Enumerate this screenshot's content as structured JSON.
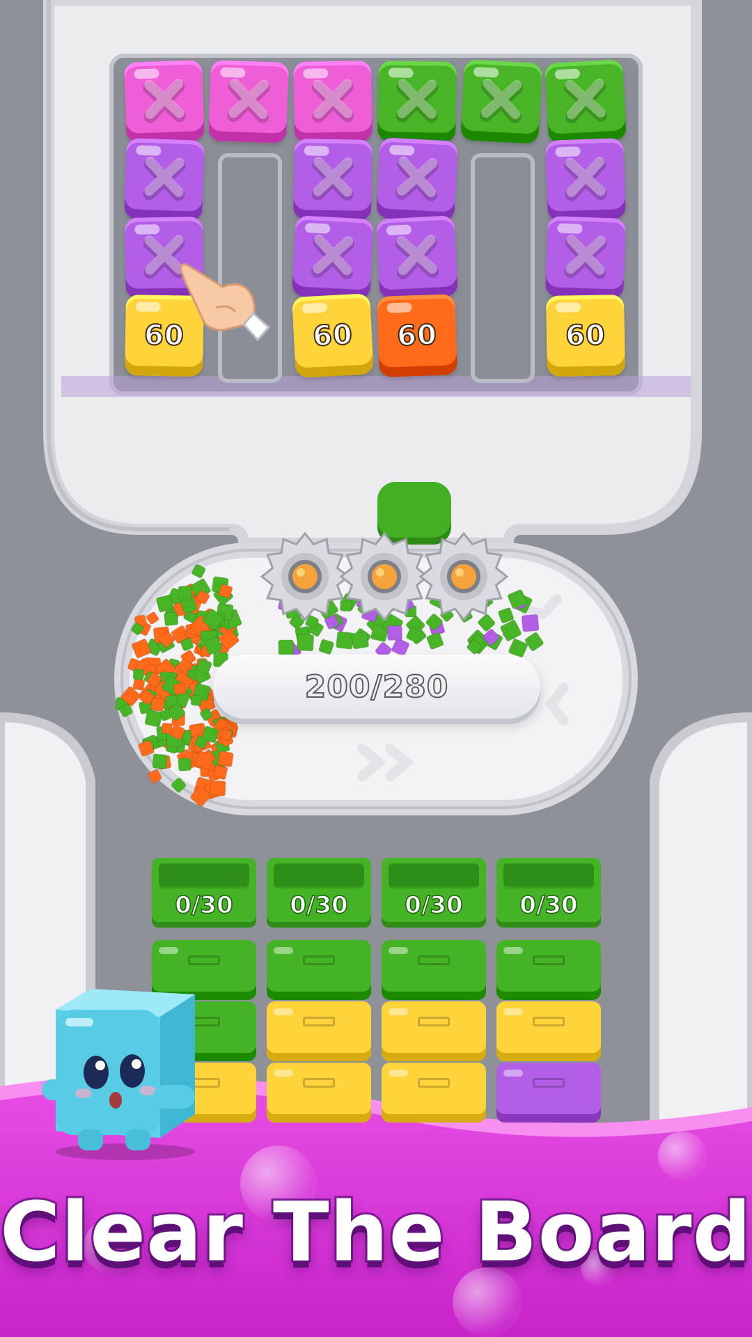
{
  "game": {
    "title": "Clear The Board",
    "counter": {
      "current": 200,
      "total": 280,
      "text": "200/280"
    },
    "grid": {
      "columns": [
        {
          "blocks": [
            {
              "color": "#ee5ed6",
              "kind": "x"
            },
            {
              "color": "#b25ee6",
              "kind": "x"
            },
            {
              "color": "#b25ee6",
              "kind": "x"
            },
            {
              "color": "#ffd43a",
              "kind": "number",
              "value": "60"
            }
          ]
        },
        {
          "blocks": [
            {
              "color": "#ee5ed6",
              "kind": "x"
            }
          ]
        },
        {
          "blocks": [
            {
              "color": "#ee5ed6",
              "kind": "x"
            },
            {
              "color": "#b25ee6",
              "kind": "x"
            },
            {
              "color": "#b25ee6",
              "kind": "x"
            },
            {
              "color": "#ffd43a",
              "kind": "number",
              "value": "60"
            }
          ]
        },
        {
          "blocks": [
            {
              "color": "#48b526",
              "kind": "x"
            },
            {
              "color": "#b25ee6",
              "kind": "x"
            },
            {
              "color": "#b25ee6",
              "kind": "x"
            },
            {
              "color": "#ff6b1a",
              "kind": "number",
              "value": "60"
            }
          ]
        },
        {
          "blocks": [
            {
              "color": "#48b526",
              "kind": "x"
            }
          ]
        },
        {
          "blocks": [
            {
              "color": "#48b526",
              "kind": "x"
            },
            {
              "color": "#b25ee6",
              "kind": "x"
            },
            {
              "color": "#b25ee6",
              "kind": "x"
            },
            {
              "color": "#ffd43a",
              "kind": "number",
              "value": "60"
            }
          ]
        }
      ]
    },
    "containers": [
      {
        "label": "0/30",
        "color": "#44b325",
        "stack": [
          "#44b325",
          "#44b325",
          "#ffd43a"
        ]
      },
      {
        "label": "0/30",
        "color": "#44b325",
        "stack": [
          "#44b325",
          "#ffd43a",
          "#ffd43a"
        ]
      },
      {
        "label": "0/30",
        "color": "#44b325",
        "stack": [
          "#44b325",
          "#ffd43a",
          "#ffd43a"
        ]
      },
      {
        "label": "0/30",
        "color": "#44b325",
        "stack": [
          "#44b325",
          "#ffd43a",
          "#b25ee6"
        ]
      }
    ],
    "icons": [
      "x-mark-icon",
      "pointing-hand-icon",
      "gear-icon",
      "jelly-cube-mascot"
    ],
    "colors": {
      "banner": "#d631d6",
      "background": "#8e9198",
      "track": "#f2f2f4",
      "green": "#48b526",
      "purple": "#b25ee6",
      "pink": "#ee5ed6",
      "yellow": "#ffd43a",
      "orange": "#ff6b1a"
    }
  }
}
